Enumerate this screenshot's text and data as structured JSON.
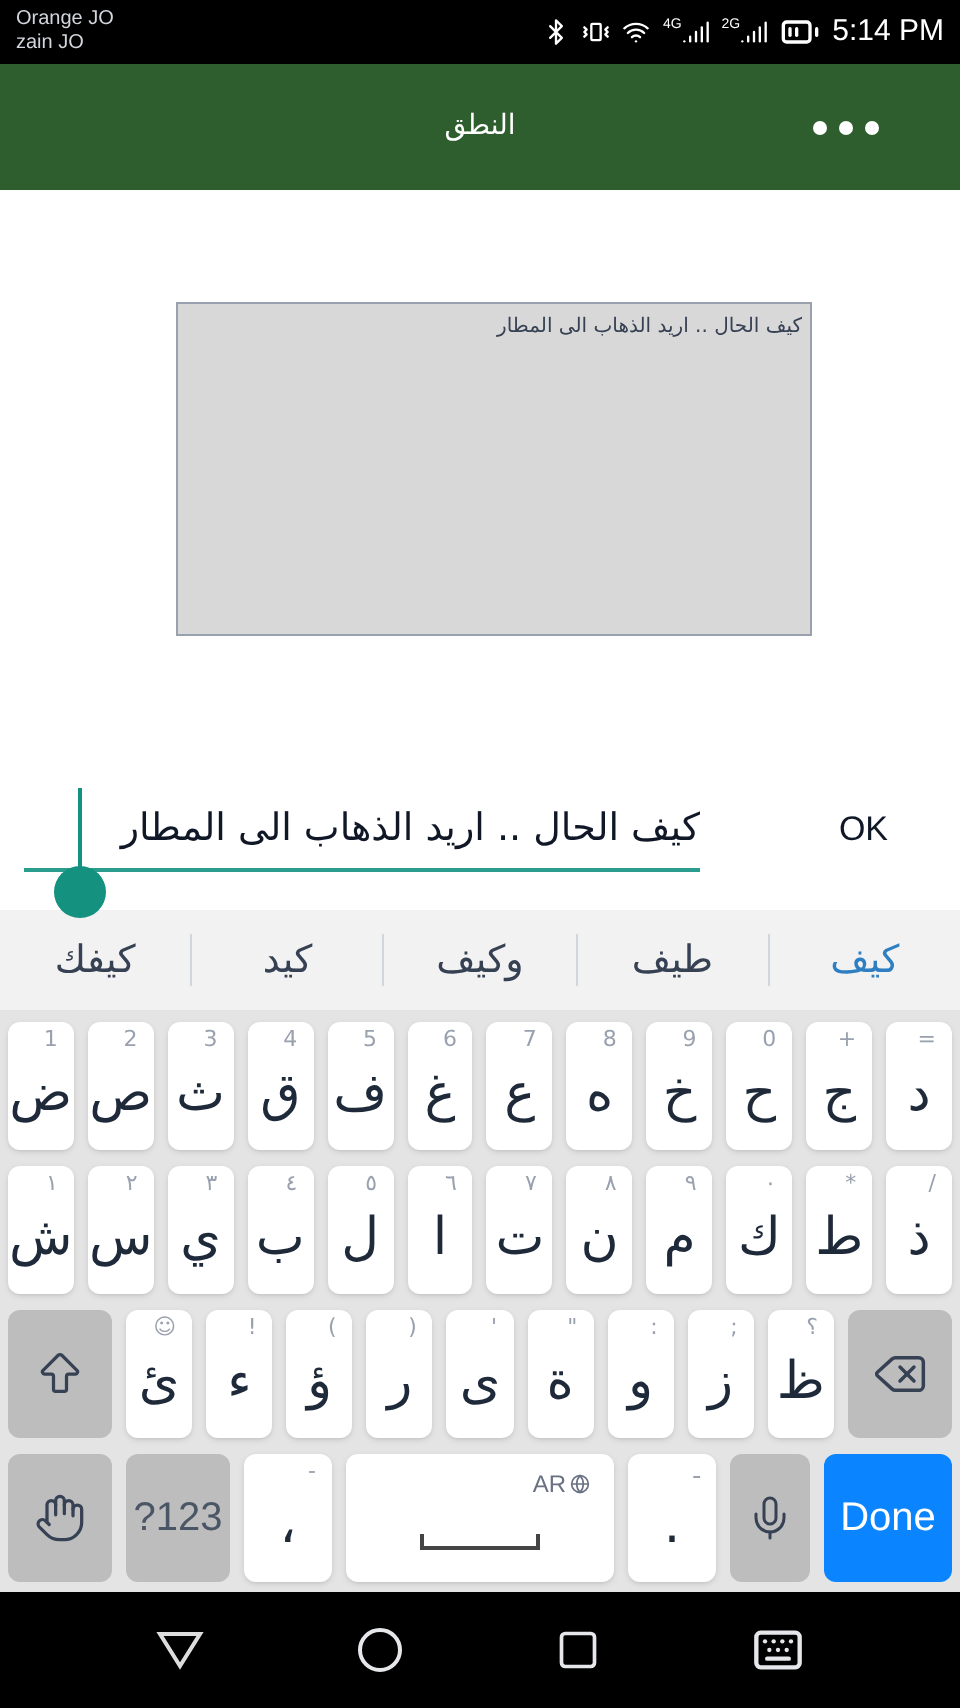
{
  "status_bar": {
    "carriers": [
      "Orange JO",
      "zain JO"
    ],
    "network_labels": [
      "2G",
      "4G"
    ],
    "time": "5:14 PM"
  },
  "app_bar": {
    "title": "النطق"
  },
  "text_display": {
    "text": "كيف الحال .. اريد الذهاب الى المطار"
  },
  "input": {
    "value": "كيف الحال .. اريد الذهاب الى المطار",
    "button": "OK"
  },
  "suggestions": [
    {
      "text": "كيف",
      "selected": true
    },
    {
      "text": "طيف",
      "selected": false
    },
    {
      "text": "وكيف",
      "selected": false
    },
    {
      "text": "كيد",
      "selected": false
    },
    {
      "text": "كيفك",
      "selected": false
    }
  ],
  "keyboard": {
    "rows": [
      [
        {
          "kind": "letter",
          "label": "د",
          "hint": "="
        },
        {
          "kind": "letter",
          "label": "ج",
          "hint": "+"
        },
        {
          "kind": "letter",
          "label": "ح",
          "hint": "0"
        },
        {
          "kind": "letter",
          "label": "خ",
          "hint": "9"
        },
        {
          "kind": "letter",
          "label": "ه",
          "hint": "8"
        },
        {
          "kind": "letter",
          "label": "ع",
          "hint": "7"
        },
        {
          "kind": "letter",
          "label": "غ",
          "hint": "6"
        },
        {
          "kind": "letter",
          "label": "ف",
          "hint": "5"
        },
        {
          "kind": "letter",
          "label": "ق",
          "hint": "4"
        },
        {
          "kind": "letter",
          "label": "ث",
          "hint": "3"
        },
        {
          "kind": "letter",
          "label": "ص",
          "hint": "2"
        },
        {
          "kind": "letter",
          "label": "ض",
          "hint": "1"
        }
      ],
      [
        {
          "kind": "letter",
          "label": "ذ",
          "hint": "/"
        },
        {
          "kind": "letter",
          "label": "ط",
          "hint": "*"
        },
        {
          "kind": "letter",
          "label": "ك",
          "hint": "٠"
        },
        {
          "kind": "letter",
          "label": "م",
          "hint": "٩"
        },
        {
          "kind": "letter",
          "label": "ن",
          "hint": "٨"
        },
        {
          "kind": "letter",
          "label": "ت",
          "hint": "٧"
        },
        {
          "kind": "letter",
          "label": "ا",
          "hint": "٦"
        },
        {
          "kind": "letter",
          "label": "ل",
          "hint": "٥"
        },
        {
          "kind": "letter",
          "label": "ب",
          "hint": "٤"
        },
        {
          "kind": "letter",
          "label": "ي",
          "hint": "٣"
        },
        {
          "kind": "letter",
          "label": "س",
          "hint": "٢"
        },
        {
          "kind": "letter",
          "label": "ش",
          "hint": "١"
        }
      ],
      [
        {
          "kind": "backspace"
        },
        {
          "kind": "letter",
          "label": "ظ",
          "hint": "؟"
        },
        {
          "kind": "letter",
          "label": "ز",
          "hint": ";"
        },
        {
          "kind": "letter",
          "label": "و",
          "hint": ":"
        },
        {
          "kind": "letter",
          "label": "ة",
          "hint": "\""
        },
        {
          "kind": "letter",
          "label": "ى",
          "hint": "'"
        },
        {
          "kind": "letter",
          "label": "ر",
          "hint": ")"
        },
        {
          "kind": "letter",
          "label": "ؤ",
          "hint": "("
        },
        {
          "kind": "letter",
          "label": "ء",
          "hint": "!"
        },
        {
          "kind": "letter",
          "label": "ئ",
          "hint": "☺"
        },
        {
          "kind": "shift"
        }
      ]
    ],
    "bottom_row": [
      {
        "kind": "done",
        "label": "Done"
      },
      {
        "kind": "mic"
      },
      {
        "kind": "letter",
        "label": ".",
        "hint": "ـ"
      },
      {
        "kind": "space",
        "hint": "AR"
      },
      {
        "kind": "letter",
        "label": "،",
        "hint": "-"
      },
      {
        "kind": "symbols",
        "label": "?123"
      },
      {
        "kind": "handwriting"
      }
    ]
  }
}
